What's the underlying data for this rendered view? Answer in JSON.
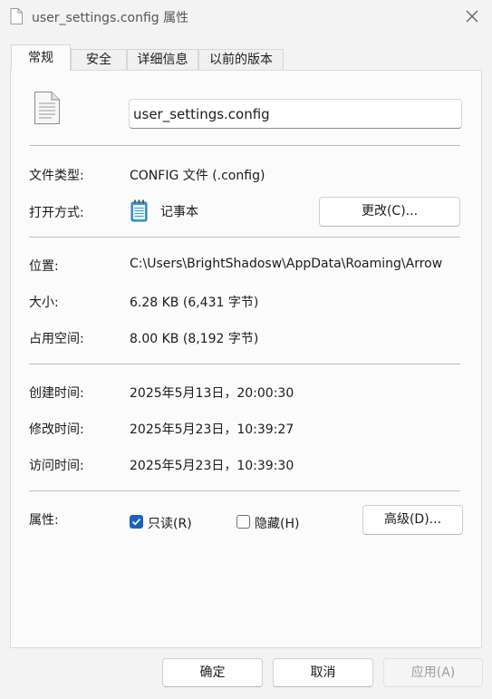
{
  "window": {
    "title": "user_settings.config 属性",
    "title_icon": "document-icon",
    "close_icon": "close-icon"
  },
  "tabs": [
    {
      "label": "常规",
      "active": true
    },
    {
      "label": "安全",
      "active": false
    },
    {
      "label": "详细信息",
      "active": false
    },
    {
      "label": "以前的版本",
      "active": false
    }
  ],
  "general": {
    "file_icon": "config-file-icon",
    "file_name": "user_settings.config",
    "file_type_label": "文件类型:",
    "file_type_value": "CONFIG 文件 (.config)",
    "open_with_label": "打开方式:",
    "open_with_icon": "notepad-icon",
    "open_with_value": "记事本",
    "change_button": "更改(C)...",
    "location_label": "位置:",
    "location_value": "C:\\Users\\BrightShadosw\\AppData\\Roaming\\Arrow",
    "size_label": "大小:",
    "size_value": "6.28 KB (6,431 字节)",
    "size_on_disk_label": "占用空间:",
    "size_on_disk_value": "8.00 KB (8,192 字节)",
    "created_label": "创建时间:",
    "created_value": "2025年5月13日，20:00:30",
    "modified_label": "修改时间:",
    "modified_value": "2025年5月23日，10:39:27",
    "accessed_label": "访问时间:",
    "accessed_value": "2025年5月23日，10:39:30",
    "attributes_label": "属性:",
    "readonly_label": "只读(R)",
    "readonly_checked": true,
    "hidden_label": "隐藏(H)",
    "hidden_checked": false,
    "advanced_button": "高级(D)..."
  },
  "footer": {
    "ok_button": "确定",
    "cancel_button": "取消",
    "apply_button": "应用(A)",
    "apply_enabled": false
  },
  "colors": {
    "accent": "#1a63b7",
    "window_bg": "#f3f3f3",
    "panel_bg": "#fbfbfb"
  }
}
